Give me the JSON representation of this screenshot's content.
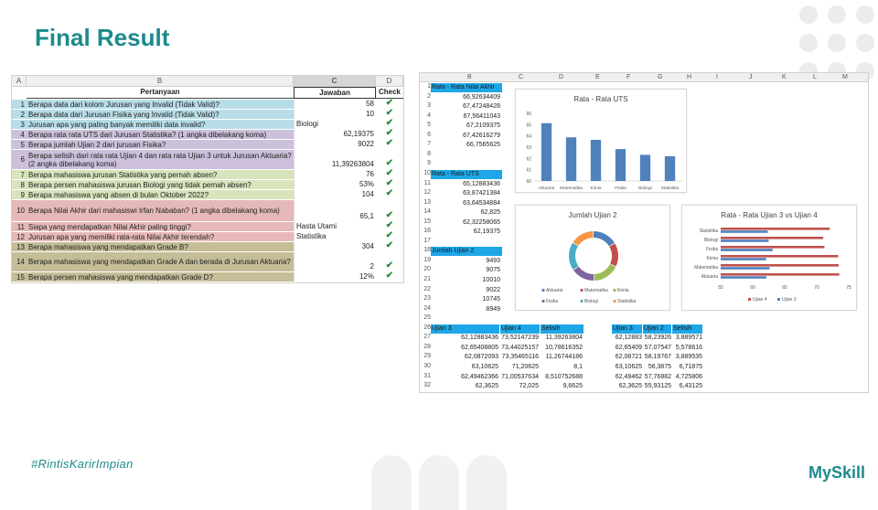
{
  "title": "Final Result",
  "hashtag": "#RintisKarirImpian",
  "brand": "MySkill",
  "sheet1": {
    "col_letters": [
      "A",
      "B",
      "C",
      "D"
    ],
    "headers": {
      "q": "Pertanyaan",
      "a": "Jawaban",
      "c": "Check"
    },
    "rows": [
      {
        "n": "1",
        "q": "Berapa data dari kolom Jurusan yang Invalid (Tidak Valid)?",
        "a": "58",
        "bg": "#b7dde8",
        "txt": false
      },
      {
        "n": "2",
        "q": "Berapa data dari Jurusan Fisika yang Invalid (Tidak Valid)?",
        "a": "10",
        "bg": "#b7dde8",
        "txt": false
      },
      {
        "n": "3",
        "q": "Jurusan apa yang paling banyak memiliki data invalid?",
        "a": "Biologi",
        "bg": "#b7dde8",
        "txt": true
      },
      {
        "n": "4",
        "q": "Berapa rata rata UTS dari Jurusan Statistika? (1 angka dibelakang koma)",
        "a": "62,19375",
        "bg": "#ccc0da",
        "txt": false
      },
      {
        "n": "5",
        "q": "Berapa jumlah Ujian 2 dari jurusan Fisika?",
        "a": "9022",
        "bg": "#ccc0da",
        "txt": false
      },
      {
        "n": "6",
        "q": "Berapa selisih dari rata rata Ujian 4 dan rata rata Ujian 3 untuk Jurusan Aktuaria? (2 angka dibelakang koma)",
        "a": "11,39263804",
        "bg": "#ccc0da",
        "txt": false
      },
      {
        "n": "7",
        "q": "Berapa mahasiswa jurusan Statistika yang pernah absen?",
        "a": "76",
        "bg": "#d7e4bc",
        "txt": false
      },
      {
        "n": "8",
        "q": "Berapa persen mahasiswa jurusan Biologi yang tidak pernah absen?",
        "a": "53%",
        "bg": "#d7e4bc",
        "txt": false
      },
      {
        "n": "9",
        "q": "Berapa mahasiswa yang absen di bulan Oktober 2022?",
        "a": "104",
        "bg": "#d7e4bc",
        "txt": false
      },
      {
        "n": "10",
        "q": "Berapa Nilai Akhir dari mahasiswi Irfan Nababan? (1 angka dibelakang koma)",
        "a": "65,1",
        "bg": "#e6b9b8",
        "txt": false
      },
      {
        "n": "11",
        "q": "Siapa yang mendapatkan Nilai Akhir paling tinggi?",
        "a": "Hasta Utami",
        "bg": "#e6b9b8",
        "txt": true
      },
      {
        "n": "12",
        "q": "Jurusan apa yang memiliki rata-rata Nilai Akhir terendah?",
        "a": "Statistika",
        "bg": "#e6b9b8",
        "txt": true
      },
      {
        "n": "13",
        "q": "Berapa mahasiswa yang mendapatkan Grade B?",
        "a": "304",
        "bg": "#c4bd97",
        "txt": false
      },
      {
        "n": "14",
        "q": "Berapa mahasiswa yang mendapatkan Grade A dan berada di Jurusan Aktuaria?",
        "a": "2",
        "bg": "#c4bd97",
        "txt": false
      },
      {
        "n": "15",
        "q": "Berapa persen mahasiswa yang mendapatkan Grade D?",
        "a": "12%",
        "bg": "#c4bd97",
        "txt": false
      }
    ],
    "check_mark": "✔"
  },
  "sheet2": {
    "col_letters": [
      "B",
      "C",
      "D",
      "E",
      "F",
      "G",
      "H",
      "I",
      "J",
      "K",
      "L",
      "M"
    ],
    "row_numbers": [
      "1",
      "2",
      "3",
      "4",
      "5",
      "6",
      "7",
      "8",
      "9",
      "10",
      "11",
      "12",
      "13",
      "14",
      "15",
      "16",
      "17",
      "18",
      "19",
      "20",
      "21",
      "22",
      "23",
      "24",
      "25",
      "26",
      "27",
      "28",
      "29",
      "30",
      "31",
      "32"
    ],
    "nilai_akhir": {
      "header": "Rata - Rata Nilai Akhir",
      "values": [
        "66,92634409",
        "67,47248428",
        "67,56411043",
        "67,2109375",
        "67,42616279",
        "66,7565625"
      ]
    },
    "uts": {
      "header": "Rata - Rata UTS",
      "values": [
        "65,12883436",
        "63,87421384",
        "63,64534884",
        "62,825",
        "62,32258065",
        "62,19375"
      ]
    },
    "ujian2": {
      "header": "Jumlah Ujian 2",
      "values": [
        "9493",
        "9075",
        "10010",
        "9022",
        "10745",
        "8949"
      ]
    },
    "table3": {
      "headers": [
        "Ujian 3",
        "Ujian 4",
        "Selisih"
      ],
      "rows": [
        [
          "62,12883436",
          "73,52147239",
          "11,39263804"
        ],
        [
          "62,65408805",
          "73,44025157",
          "10,78616352"
        ],
        [
          "62,0872093",
          "73,35465116",
          "11,26744186"
        ],
        [
          "63,10625",
          "71,20625",
          "8,1"
        ],
        [
          "62,49462366",
          "71,00537634",
          "8,510752688"
        ],
        [
          "62,3625",
          "72,025",
          "9,6625"
        ]
      ]
    },
    "table4": {
      "headers": [
        "Ujian 3",
        "Ujian 2",
        "Selisih"
      ],
      "rows": [
        [
          "62,12883",
          "58,23926",
          "3,889571"
        ],
        [
          "62,65409",
          "57,07547",
          "5,578616"
        ],
        [
          "62,08721",
          "58,19767",
          "3,889535"
        ],
        [
          "63,10625",
          "56,3875",
          "6,71875"
        ],
        [
          "62,49462",
          "57,76882",
          "4,725806"
        ],
        [
          "62,3625",
          "55,93125",
          "6,43125"
        ]
      ]
    }
  },
  "chart_data": [
    {
      "type": "bar",
      "title": "Rata - Rata UTS",
      "categories": [
        "Aktuaria",
        "Matematika",
        "Kimia",
        "Fisika",
        "Biologi",
        "Statistika"
      ],
      "values": [
        65.13,
        63.87,
        63.65,
        62.83,
        62.32,
        62.19
      ],
      "ylim": [
        60,
        66
      ],
      "yticks": [
        "60",
        "61",
        "62",
        "63",
        "64",
        "65",
        "66"
      ],
      "color": "#4f81bd"
    },
    {
      "type": "pie",
      "title": "Jumlah Ujian 2",
      "categories": [
        "Aktuaria",
        "Matematika",
        "Kimia",
        "Fisika",
        "Biologi",
        "Statistika"
      ],
      "values": [
        9493,
        9075,
        10010,
        9022,
        10745,
        8949
      ],
      "colors": [
        "#4f81bd",
        "#c0504d",
        "#9bbb59",
        "#8064a2",
        "#4bacc6",
        "#f79646"
      ]
    },
    {
      "type": "bar",
      "orientation": "horizontal",
      "title": "Rata - Rata Ujian 3 vs Ujian 4",
      "categories": [
        "Statistika",
        "Biologi",
        "Fisika",
        "Kimia",
        "Matematika",
        "Aktuaria"
      ],
      "series": [
        {
          "name": "Ujian 4",
          "values": [
            72.03,
            71.01,
            71.21,
            73.35,
            73.44,
            73.52
          ],
          "color": "#c0504d"
        },
        {
          "name": "Ujian 3",
          "values": [
            62.36,
            62.49,
            63.11,
            62.09,
            62.65,
            62.13
          ],
          "color": "#4f81bd"
        }
      ],
      "xlim": [
        55,
        75
      ],
      "xticks": [
        "55",
        "60",
        "65",
        "70",
        "75"
      ]
    }
  ]
}
